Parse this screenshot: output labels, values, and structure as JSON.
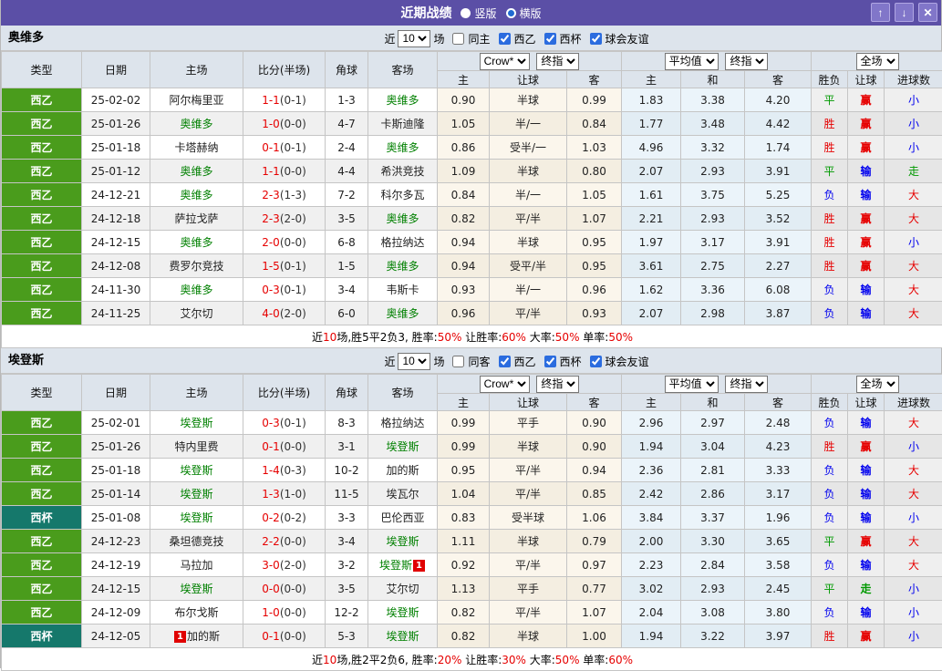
{
  "titlebar": {
    "title": "近期战绩",
    "options": [
      {
        "label": "竖版",
        "selected": false
      },
      {
        "label": "横版",
        "selected": true
      }
    ],
    "buttons": {
      "up": "↑",
      "down": "↓",
      "close": "✕"
    }
  },
  "filter_labels": {
    "near": "近",
    "count": "10",
    "games": "场",
    "leagues": [
      "西乙",
      "西杯",
      "球会友谊"
    ]
  },
  "columns": {
    "type": "类型",
    "date": "日期",
    "home": "主场",
    "score": "比分(半场)",
    "corner": "角球",
    "away": "客场",
    "asian_select": "Crow*",
    "asian_final": "终指",
    "euro_select": "平均值",
    "euro_final": "终指",
    "full_select": "全场",
    "sub": [
      "主",
      "让球",
      "客",
      "主",
      "和",
      "客",
      "胜负",
      "让球",
      "进球数"
    ]
  },
  "colors": {
    "titlebar_bg": "#5b4fa6",
    "button_bg": "#8176c9",
    "header_bg": "#dde4ec",
    "league_green": "#4a9c1c",
    "cup_teal": "#15786b",
    "win_red": "#e60000",
    "draw_green": "#009900",
    "lose_blue": "#0000ee",
    "team_green": "#008000",
    "asian_col_bg": "#fbf6ec",
    "euro_col_bg": "#ebf4fa",
    "result_col_bg": "#efefef"
  },
  "sections": [
    {
      "team": "奥维多",
      "same_label": "同主",
      "rows": [
        {
          "league": "西乙",
          "cup": false,
          "date": "25-02-02",
          "home": "阿尔梅里亚",
          "home_hl": false,
          "home_badge": "",
          "score": "1-1",
          "half": "(0-1)",
          "corner": "1-3",
          "away": "奥维多",
          "away_hl": true,
          "away_badge": "",
          "asian": [
            "0.90",
            "半球",
            "0.99"
          ],
          "euro": [
            "1.83",
            "3.38",
            "4.20"
          ],
          "res": [
            "平",
            "赢",
            "小"
          ]
        },
        {
          "league": "西乙",
          "cup": false,
          "date": "25-01-26",
          "home": "奥维多",
          "home_hl": true,
          "home_badge": "",
          "score": "1-0",
          "half": "(0-0)",
          "corner": "4-7",
          "away": "卡斯迪隆",
          "away_hl": false,
          "away_badge": "",
          "asian": [
            "1.05",
            "半/一",
            "0.84"
          ],
          "euro": [
            "1.77",
            "3.48",
            "4.42"
          ],
          "res": [
            "胜",
            "赢",
            "小"
          ]
        },
        {
          "league": "西乙",
          "cup": false,
          "date": "25-01-18",
          "home": "卡塔赫纳",
          "home_hl": false,
          "home_badge": "",
          "score": "0-1",
          "half": "(0-1)",
          "corner": "2-4",
          "away": "奥维多",
          "away_hl": true,
          "away_badge": "",
          "asian": [
            "0.86",
            "受半/一",
            "1.03"
          ],
          "euro": [
            "4.96",
            "3.32",
            "1.74"
          ],
          "res": [
            "胜",
            "赢",
            "小"
          ]
        },
        {
          "league": "西乙",
          "cup": false,
          "date": "25-01-12",
          "home": "奥维多",
          "home_hl": true,
          "home_badge": "",
          "score": "1-1",
          "half": "(0-0)",
          "corner": "4-4",
          "away": "希洪竞技",
          "away_hl": false,
          "away_badge": "",
          "asian": [
            "1.09",
            "半球",
            "0.80"
          ],
          "euro": [
            "2.07",
            "2.93",
            "3.91"
          ],
          "res": [
            "平",
            "输",
            "走"
          ]
        },
        {
          "league": "西乙",
          "cup": false,
          "date": "24-12-21",
          "home": "奥维多",
          "home_hl": true,
          "home_badge": "",
          "score": "2-3",
          "half": "(1-3)",
          "corner": "7-2",
          "away": "科尔多瓦",
          "away_hl": false,
          "away_badge": "",
          "asian": [
            "0.84",
            "半/一",
            "1.05"
          ],
          "euro": [
            "1.61",
            "3.75",
            "5.25"
          ],
          "res": [
            "负",
            "输",
            "大"
          ]
        },
        {
          "league": "西乙",
          "cup": false,
          "date": "24-12-18",
          "home": "萨拉戈萨",
          "home_hl": false,
          "home_badge": "",
          "score": "2-3",
          "half": "(2-0)",
          "corner": "3-5",
          "away": "奥维多",
          "away_hl": true,
          "away_badge": "",
          "asian": [
            "0.82",
            "平/半",
            "1.07"
          ],
          "euro": [
            "2.21",
            "2.93",
            "3.52"
          ],
          "res": [
            "胜",
            "赢",
            "大"
          ]
        },
        {
          "league": "西乙",
          "cup": false,
          "date": "24-12-15",
          "home": "奥维多",
          "home_hl": true,
          "home_badge": "",
          "score": "2-0",
          "half": "(0-0)",
          "corner": "6-8",
          "away": "格拉纳达",
          "away_hl": false,
          "away_badge": "",
          "asian": [
            "0.94",
            "半球",
            "0.95"
          ],
          "euro": [
            "1.97",
            "3.17",
            "3.91"
          ],
          "res": [
            "胜",
            "赢",
            "小"
          ]
        },
        {
          "league": "西乙",
          "cup": false,
          "date": "24-12-08",
          "home": "费罗尔竞技",
          "home_hl": false,
          "home_badge": "",
          "score": "1-5",
          "half": "(0-1)",
          "corner": "1-5",
          "away": "奥维多",
          "away_hl": true,
          "away_badge": "",
          "asian": [
            "0.94",
            "受平/半",
            "0.95"
          ],
          "euro": [
            "3.61",
            "2.75",
            "2.27"
          ],
          "res": [
            "胜",
            "赢",
            "大"
          ]
        },
        {
          "league": "西乙",
          "cup": false,
          "date": "24-11-30",
          "home": "奥维多",
          "home_hl": true,
          "home_badge": "",
          "score": "0-3",
          "half": "(0-1)",
          "corner": "3-4",
          "away": "韦斯卡",
          "away_hl": false,
          "away_badge": "",
          "asian": [
            "0.93",
            "半/一",
            "0.96"
          ],
          "euro": [
            "1.62",
            "3.36",
            "6.08"
          ],
          "res": [
            "负",
            "输",
            "大"
          ]
        },
        {
          "league": "西乙",
          "cup": false,
          "date": "24-11-25",
          "home": "艾尔切",
          "home_hl": false,
          "home_badge": "",
          "score": "4-0",
          "half": "(2-0)",
          "corner": "6-0",
          "away": "奥维多",
          "away_hl": true,
          "away_badge": "",
          "asian": [
            "0.96",
            "平/半",
            "0.93"
          ],
          "euro": [
            "2.07",
            "2.98",
            "3.87"
          ],
          "res": [
            "负",
            "输",
            "大"
          ]
        }
      ],
      "summary": [
        {
          "t": "近"
        },
        {
          "t": "10",
          "r": 1
        },
        {
          "t": "场,胜5平2负3, 胜率:"
        },
        {
          "t": "50%",
          "r": 1
        },
        {
          "t": " 让胜率:"
        },
        {
          "t": "60%",
          "r": 1
        },
        {
          "t": " 大率:"
        },
        {
          "t": "50%",
          "r": 1
        },
        {
          "t": " 单率:"
        },
        {
          "t": "50%",
          "r": 1
        }
      ]
    },
    {
      "team": "埃登斯",
      "same_label": "同客",
      "rows": [
        {
          "league": "西乙",
          "cup": false,
          "date": "25-02-01",
          "home": "埃登斯",
          "home_hl": true,
          "home_badge": "",
          "score": "0-3",
          "half": "(0-1)",
          "corner": "8-3",
          "away": "格拉纳达",
          "away_hl": false,
          "away_badge": "",
          "asian": [
            "0.99",
            "平手",
            "0.90"
          ],
          "euro": [
            "2.96",
            "2.97",
            "2.48"
          ],
          "res": [
            "负",
            "输",
            "大"
          ]
        },
        {
          "league": "西乙",
          "cup": false,
          "date": "25-01-26",
          "home": "特内里费",
          "home_hl": false,
          "home_badge": "",
          "score": "0-1",
          "half": "(0-0)",
          "corner": "3-1",
          "away": "埃登斯",
          "away_hl": true,
          "away_badge": "",
          "asian": [
            "0.99",
            "半球",
            "0.90"
          ],
          "euro": [
            "1.94",
            "3.04",
            "4.23"
          ],
          "res": [
            "胜",
            "赢",
            "小"
          ]
        },
        {
          "league": "西乙",
          "cup": false,
          "date": "25-01-18",
          "home": "埃登斯",
          "home_hl": true,
          "home_badge": "",
          "score": "1-4",
          "half": "(0-3)",
          "corner": "10-2",
          "away": "加的斯",
          "away_hl": false,
          "away_badge": "",
          "asian": [
            "0.95",
            "平/半",
            "0.94"
          ],
          "euro": [
            "2.36",
            "2.81",
            "3.33"
          ],
          "res": [
            "负",
            "输",
            "大"
          ]
        },
        {
          "league": "西乙",
          "cup": false,
          "date": "25-01-14",
          "home": "埃登斯",
          "home_hl": true,
          "home_badge": "",
          "score": "1-3",
          "half": "(1-0)",
          "corner": "11-5",
          "away": "埃瓦尔",
          "away_hl": false,
          "away_badge": "",
          "asian": [
            "1.04",
            "平/半",
            "0.85"
          ],
          "euro": [
            "2.42",
            "2.86",
            "3.17"
          ],
          "res": [
            "负",
            "输",
            "大"
          ]
        },
        {
          "league": "西杯",
          "cup": true,
          "date": "25-01-08",
          "home": "埃登斯",
          "home_hl": true,
          "home_badge": "",
          "score": "0-2",
          "half": "(0-2)",
          "corner": "3-3",
          "away": "巴伦西亚",
          "away_hl": false,
          "away_badge": "",
          "asian": [
            "0.83",
            "受半球",
            "1.06"
          ],
          "euro": [
            "3.84",
            "3.37",
            "1.96"
          ],
          "res": [
            "负",
            "输",
            "小"
          ]
        },
        {
          "league": "西乙",
          "cup": false,
          "date": "24-12-23",
          "home": "桑坦德竞技",
          "home_hl": false,
          "home_badge": "",
          "score": "2-2",
          "half": "(0-0)",
          "corner": "3-4",
          "away": "埃登斯",
          "away_hl": true,
          "away_badge": "",
          "asian": [
            "1.11",
            "半球",
            "0.79"
          ],
          "euro": [
            "2.00",
            "3.30",
            "3.65"
          ],
          "res": [
            "平",
            "赢",
            "大"
          ]
        },
        {
          "league": "西乙",
          "cup": false,
          "date": "24-12-19",
          "home": "马拉加",
          "home_hl": false,
          "home_badge": "",
          "score": "3-0",
          "half": "(2-0)",
          "corner": "3-2",
          "away": "埃登斯",
          "away_hl": true,
          "away_badge": "1",
          "asian": [
            "0.92",
            "平/半",
            "0.97"
          ],
          "euro": [
            "2.23",
            "2.84",
            "3.58"
          ],
          "res": [
            "负",
            "输",
            "大"
          ]
        },
        {
          "league": "西乙",
          "cup": false,
          "date": "24-12-15",
          "home": "埃登斯",
          "home_hl": true,
          "home_badge": "",
          "score": "0-0",
          "half": "(0-0)",
          "corner": "3-5",
          "away": "艾尔切",
          "away_hl": false,
          "away_badge": "",
          "asian": [
            "1.13",
            "平手",
            "0.77"
          ],
          "euro": [
            "3.02",
            "2.93",
            "2.45"
          ],
          "res": [
            "平",
            "走",
            "小"
          ]
        },
        {
          "league": "西乙",
          "cup": false,
          "date": "24-12-09",
          "home": "布尔戈斯",
          "home_hl": false,
          "home_badge": "",
          "score": "1-0",
          "half": "(0-0)",
          "corner": "12-2",
          "away": "埃登斯",
          "away_hl": true,
          "away_badge": "",
          "asian": [
            "0.82",
            "平/半",
            "1.07"
          ],
          "euro": [
            "2.04",
            "3.08",
            "3.80"
          ],
          "res": [
            "负",
            "输",
            "小"
          ]
        },
        {
          "league": "西杯",
          "cup": true,
          "date": "24-12-05",
          "home": "加的斯",
          "home_hl": false,
          "home_badge": "1",
          "score": "0-1",
          "half": "(0-0)",
          "corner": "5-3",
          "away": "埃登斯",
          "away_hl": true,
          "away_badge": "",
          "asian": [
            "0.82",
            "半球",
            "1.00"
          ],
          "euro": [
            "1.94",
            "3.22",
            "3.97"
          ],
          "res": [
            "胜",
            "赢",
            "小"
          ]
        }
      ],
      "summary": [
        {
          "t": "近"
        },
        {
          "t": "10",
          "r": 1
        },
        {
          "t": "场,胜2平2负6, 胜率:"
        },
        {
          "t": "20%",
          "r": 1
        },
        {
          "t": " 让胜率:"
        },
        {
          "t": "30%",
          "r": 1
        },
        {
          "t": " 大率:"
        },
        {
          "t": "50%",
          "r": 1
        },
        {
          "t": " 单率:"
        },
        {
          "t": "60%",
          "r": 1
        }
      ]
    }
  ]
}
